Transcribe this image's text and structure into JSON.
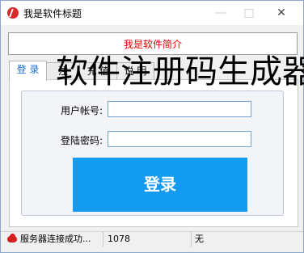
{
  "window": {
    "title": "我是软件标题"
  },
  "intro": {
    "text": "我是软件简介"
  },
  "overlay": {
    "text": "软件注册码生成器"
  },
  "tabs": [
    {
      "label": "登 录"
    },
    {
      "label": "注"
    },
    {
      "label": "充 值"
    },
    {
      "label": "说 明"
    }
  ],
  "form": {
    "username_label": "用户帐号:",
    "username_value": "",
    "password_label": "登陆密码:",
    "password_value": "",
    "login_label": "登录"
  },
  "status": {
    "message": "服务器连接成功...",
    "code": "1078",
    "extra": "无"
  }
}
